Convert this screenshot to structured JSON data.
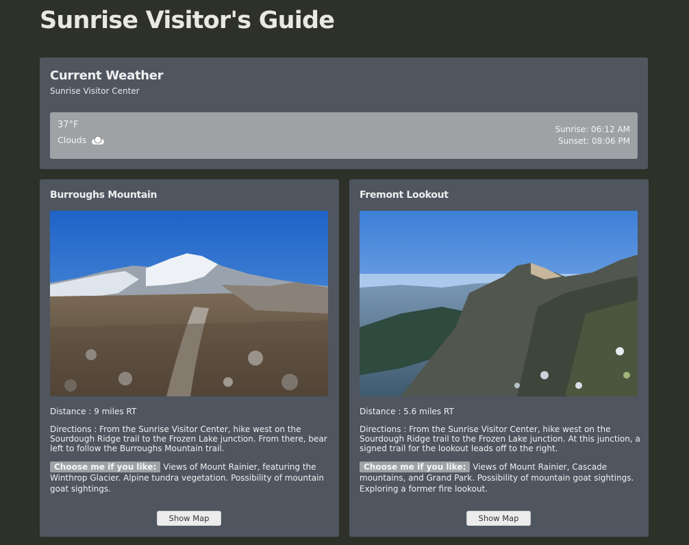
{
  "page": {
    "title": "Sunrise Visitor's Guide"
  },
  "weather": {
    "heading": "Current Weather",
    "location": "Sunrise Visitor Center",
    "temperature": "37°F",
    "conditions": "Clouds",
    "conditions_icon": "cloud-icon",
    "sunrise": "Sunrise: 06:12 AM",
    "sunset": "Sunset: 08:06 PM"
  },
  "trails": [
    {
      "name": "Burroughs Mountain",
      "distance": "Distance : 9 miles RT",
      "directions": "Directions : From the Sunrise Visitor Center, hike west on the Sourdough Ridge trail to the Frozen Lake junction. From there, bear left to follow the Burroughs Mountain trail.",
      "choose_label": "Choose me if you like:",
      "choose_text": "Views of Mount Rainier, featuring the Winthrop Glacier. Alpine tundra vegetation. Possibility of mountain goat sightings.",
      "button_label": "Show Map"
    },
    {
      "name": "Fremont Lookout",
      "distance": "Distance : 5.6 miles RT",
      "directions": "Directions : From the Sunrise Visitor Center, hike west on the Sourdough Ridge trail to the Frozen Lake junction. At this junction, a signed trail for the lookout leads off to the right.",
      "choose_label": "Choose me if you like:",
      "choose_text": "Views of Mount Rainier, Cascade mountains, and Grand Park. Possibility of mountain goat sightings. Exploring a former fire lookout.",
      "button_label": "Show Map"
    }
  ],
  "colors": {
    "background": "#2e3128",
    "panel": "#4f5660",
    "weather_box": "#9ea2a5",
    "tag": "#9ea2a5"
  }
}
